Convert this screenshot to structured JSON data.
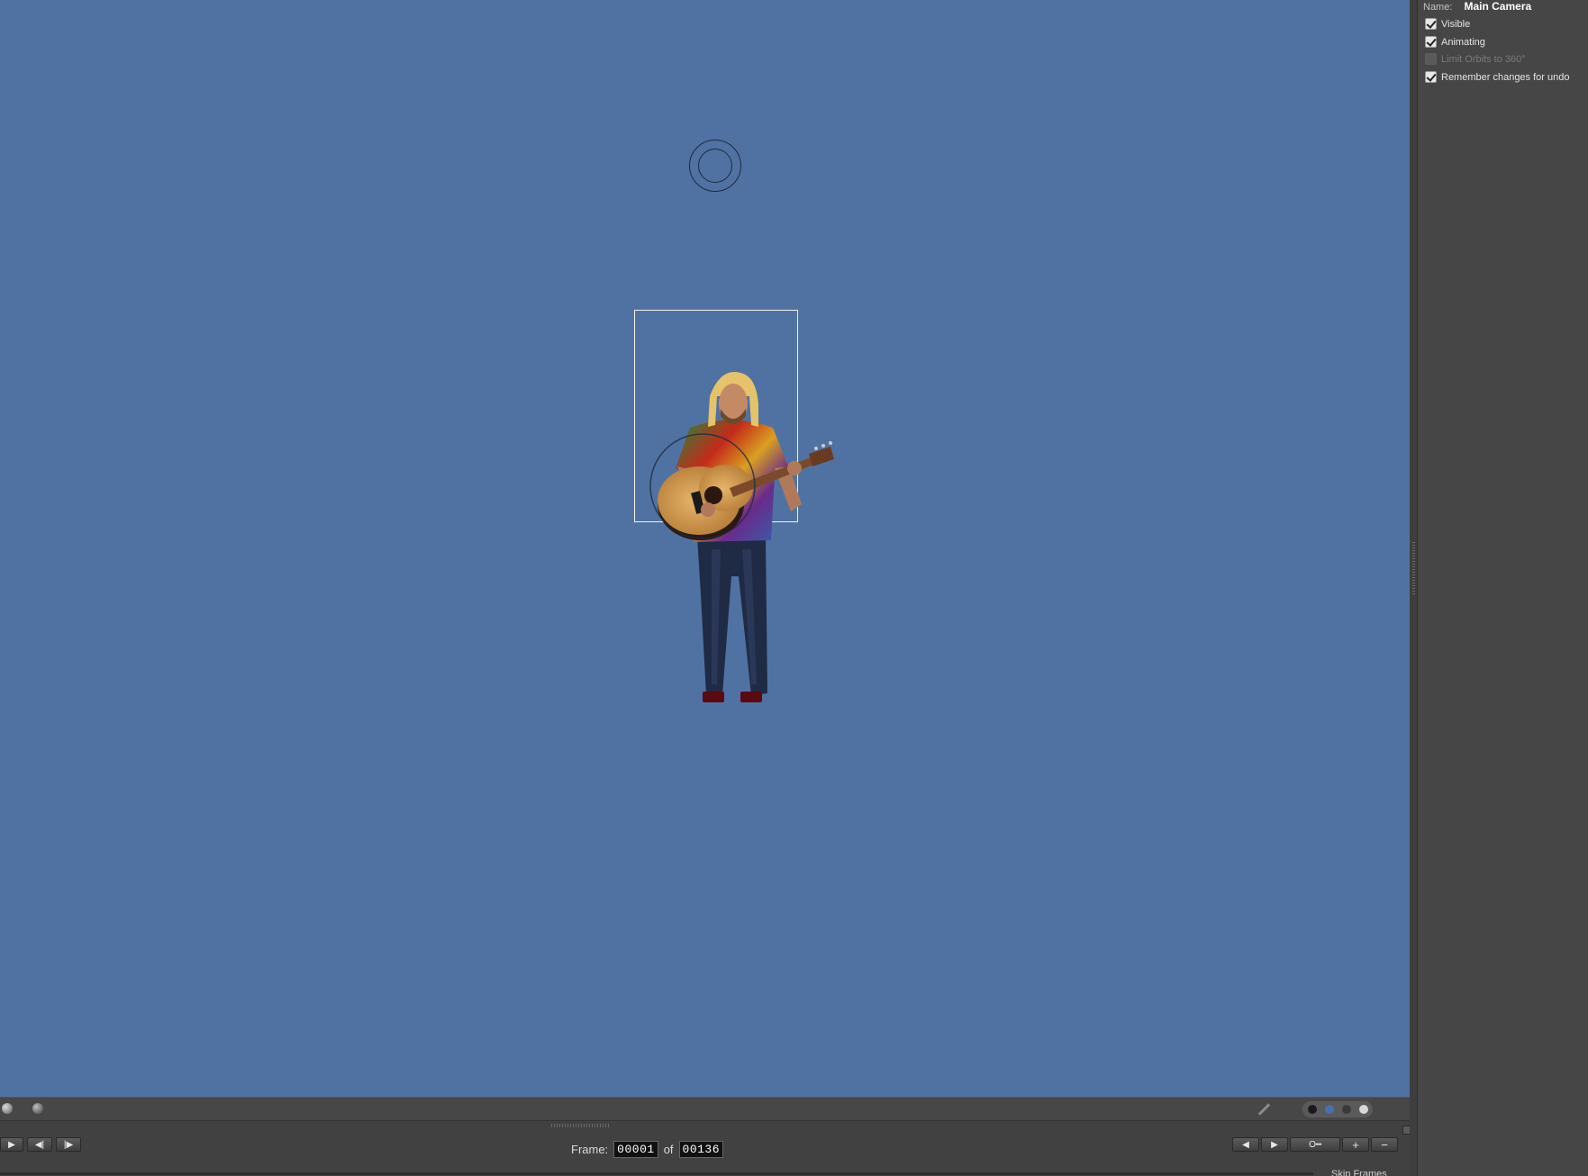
{
  "panel": {
    "name_label": "Name:",
    "name_value": "Main Camera",
    "options": [
      {
        "label": "Visible",
        "checked": true,
        "enabled": true
      },
      {
        "label": "Animating",
        "checked": true,
        "enabled": true
      },
      {
        "label": "Limit Orbits to 360°",
        "checked": false,
        "enabled": false
      },
      {
        "label": "Remember changes for undo",
        "checked": true,
        "enabled": true
      }
    ]
  },
  "timeline": {
    "frame_label": "Frame:",
    "current_frame": "00001",
    "of_label": "of",
    "total_frames": "00136",
    "skip_frames_label": "Skip Frames",
    "play_glyph": "▶",
    "prev_glyph": "◀|",
    "next_glyph": "|▶",
    "key_prev_glyph": "◀",
    "key_next_glyph": "▶",
    "key_glyph": "O━",
    "add_glyph": "+",
    "remove_glyph": "−"
  },
  "colors": {
    "viewport_bg": "#5072a2",
    "panel_bg": "#464646",
    "timeline_bg": "#414141"
  }
}
